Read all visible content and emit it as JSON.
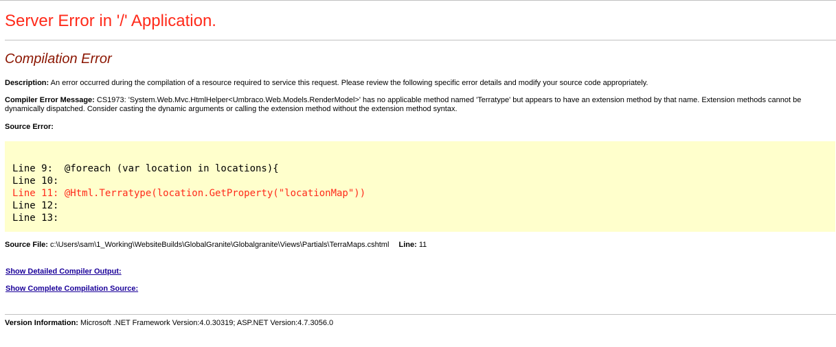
{
  "page": {
    "title": "Server Error in '/' Application.",
    "subtitle": "Compilation Error"
  },
  "description": {
    "label": "Description:",
    "text": "An error occurred during the compilation of a resource required to service this request. Please review the following specific error details and modify your source code appropriately."
  },
  "compiler_error": {
    "label": "Compiler Error Message:",
    "text": "CS1973: 'System.Web.Mvc.HtmlHelper<Umbraco.Web.Models.RenderModel>' has no applicable method named 'Terratype' but appears to have an extension method by that name. Extension methods cannot be dynamically dispatched. Consider casting the dynamic arguments or calling the extension method without the extension method syntax."
  },
  "source_error": {
    "label": "Source Error:",
    "lines": [
      {
        "text": "Line 9:  @foreach (var location in locations){",
        "is_error": false
      },
      {
        "text": "Line 10: ",
        "is_error": false
      },
      {
        "text": "Line 11: @Html.Terratype(location.GetProperty(\"locationMap\"))",
        "is_error": true
      },
      {
        "text": "Line 12: ",
        "is_error": false
      },
      {
        "text": "Line 13: ",
        "is_error": false
      }
    ]
  },
  "source_file": {
    "label": "Source File:",
    "path": "c:\\Users\\sam\\1_Working\\WebsiteBuilds\\GlobalGranite\\Globalgranite\\Views\\Partials\\TerraMaps.cshtml",
    "line_label": "Line:",
    "line_number": "11"
  },
  "links": {
    "detailed_output": "Show Detailed Compiler Output:",
    "complete_source": "Show Complete Compilation Source:"
  },
  "version": {
    "label": "Version Information:",
    "text": "Microsoft .NET Framework Version:4.0.30319; ASP.NET Version:4.7.3056.0"
  },
  "colors": {
    "title_red": "#ff2a1a",
    "subtitle_maroon": "#8b1500",
    "code_background": "#ffffcc",
    "link_blue": "#1a0099",
    "rule_gray": "#c0c0c0"
  }
}
